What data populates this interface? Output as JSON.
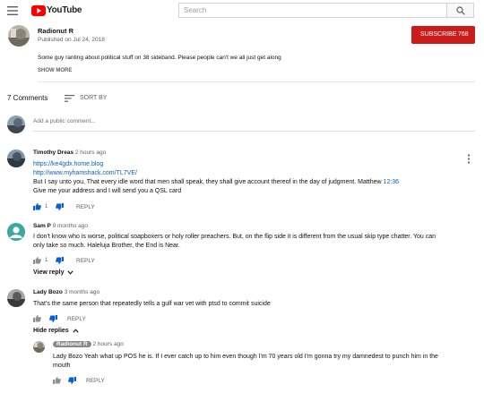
{
  "header": {
    "brand": "YouTube",
    "search_placeholder": "Search"
  },
  "channel": {
    "name": "Radionut R",
    "published": "Published on Jul 24, 2018",
    "subscribe_label": "SUBSCRIBE",
    "subscriber_count": "768",
    "description": "Some guy ranting about political stuff on 38 sideband. Please people can't we all just get along",
    "show_more": "SHOW MORE"
  },
  "comments_header": {
    "count": "7 Comments",
    "sort_label": "SORT BY",
    "add_placeholder": "Add a public comment..."
  },
  "comments": [
    {
      "author": "Timothy Dreas",
      "time": "2 hours ago",
      "link1": "https://ke4gdx.home.blog",
      "link2": "http://www.myhamshack.com/TL7VE/",
      "line1": "But I say unto you, That every idle word that men shall speak, they shall give account thereof in the day of judgment. Matthew",
      "timestamp_link": "12:36",
      "line2": "Give me your address and I will send you a QSL card",
      "likes": "1",
      "reply": "REPLY"
    },
    {
      "author": "Sam P",
      "time": "9 months ago",
      "line1": "I don't know who is worse, political soapboxers or holy roller preachers. But, on the flip side it is different from the usual skip type chatter. You can",
      "line2": "only take so much. Haleluja Brother, the End is Near.",
      "likes": "1",
      "reply": "REPLY",
      "view_reply": "View reply"
    },
    {
      "author": "Lady Bozo",
      "time": "3 months ago",
      "line1": "That's the same person that repeatedly tells a gulf war vet with ptsd to commit suicide",
      "reply": "REPLY",
      "hide_replies": "Hide replies"
    }
  ],
  "reply": {
    "author": "Radionut R",
    "time": "2 hours ago",
    "line1": "Lady Bozo Yeah what up POS he is. If I ever catch up to him even though I'm 70 years old I'm gonna try my damnedest to punch him in the",
    "line2": "mouth",
    "reply": "REPLY"
  }
}
